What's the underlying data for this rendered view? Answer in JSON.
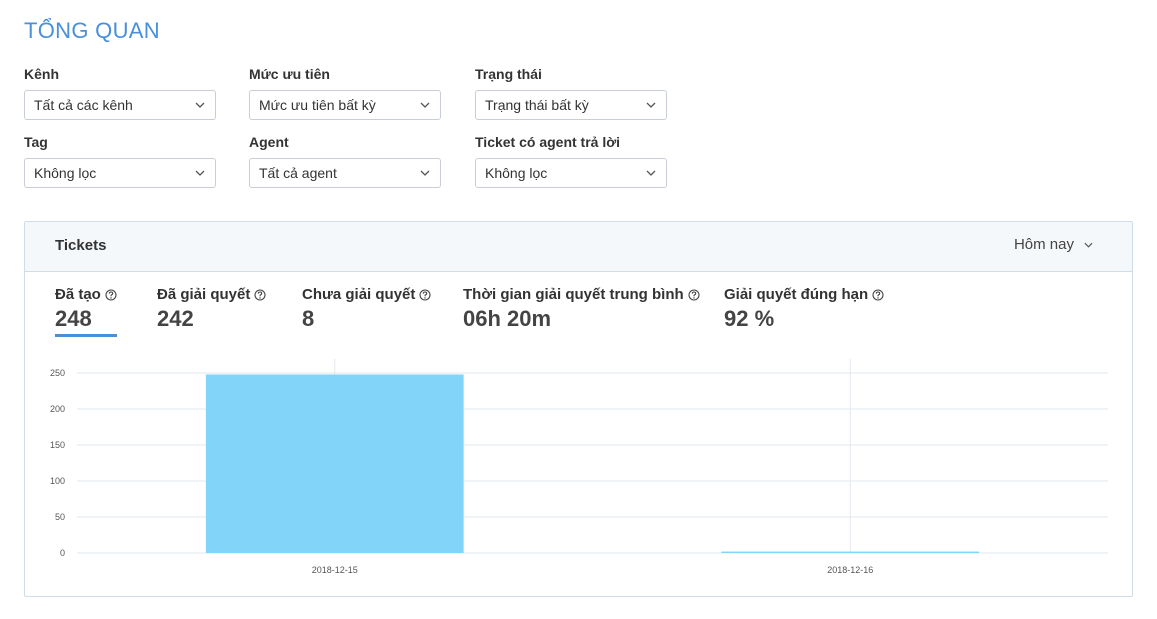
{
  "page": {
    "title": "TỔNG QUAN"
  },
  "filters": {
    "channel": {
      "label": "Kênh",
      "value": "Tất cả các kênh"
    },
    "priority": {
      "label": "Mức ưu tiên",
      "value": "Mức ưu tiên bất kỳ"
    },
    "status": {
      "label": "Trạng thái",
      "value": "Trạng thái bất kỳ"
    },
    "tag": {
      "label": "Tag",
      "value": "Không lọc"
    },
    "agent": {
      "label": "Agent",
      "value": "Tất cả agent"
    },
    "agent_replied": {
      "label": "Ticket có agent trả lời",
      "value": "Không lọc"
    }
  },
  "tickets_card": {
    "title": "Tickets",
    "period": "Hôm nay",
    "stats": [
      {
        "label": "Đã tạo",
        "value": "248"
      },
      {
        "label": "Đã giải quyết",
        "value": "242"
      },
      {
        "label": "Chưa giải quyết",
        "value": "8"
      },
      {
        "label": "Thời gian giải quyết trung bình",
        "value": "06h 20m"
      },
      {
        "label": "Giải quyết đúng hạn",
        "value": "92 %"
      }
    ]
  },
  "colors": {
    "accent": "#4a90d9",
    "bar": "#82d4f8",
    "grid": "#e3e8ee"
  },
  "icons": {
    "dropdown": "chevron-down-icon",
    "help": "question-circle-icon"
  },
  "chart_data": {
    "type": "bar",
    "categories": [
      "2018-12-15",
      "2018-12-16"
    ],
    "values": [
      248,
      2
    ],
    "yticks": [
      0,
      50,
      100,
      150,
      200,
      250
    ],
    "ylim": [
      0,
      250
    ],
    "grid": true,
    "title": "",
    "xlabel": "",
    "ylabel": ""
  }
}
